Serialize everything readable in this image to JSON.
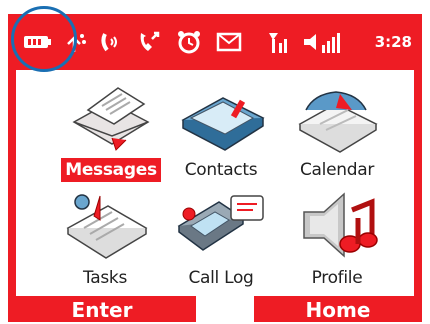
{
  "status_bar": {
    "time": "3:28",
    "icons": [
      "battery-icon",
      "bluetooth-icon",
      "headset-icon",
      "missed-call-icon",
      "alarm-icon",
      "message-icon",
      "signal-icon",
      "volume-icon"
    ]
  },
  "menu": {
    "items": [
      {
        "label": "Messages",
        "icon": "envelope-icon",
        "selected": true
      },
      {
        "label": "Contacts",
        "icon": "contacts-icon",
        "selected": false
      },
      {
        "label": "Calendar",
        "icon": "calendar-icon",
        "selected": false
      },
      {
        "label": "Tasks",
        "icon": "tasks-icon",
        "selected": false
      },
      {
        "label": "Call Log",
        "icon": "call-log-icon",
        "selected": false
      },
      {
        "label": "Profile",
        "icon": "profile-icon",
        "selected": false
      }
    ]
  },
  "softkeys": {
    "left": "Enter",
    "right": "Home"
  },
  "colors": {
    "accent": "#ee1c24",
    "highlight": "#1a6fb3"
  }
}
